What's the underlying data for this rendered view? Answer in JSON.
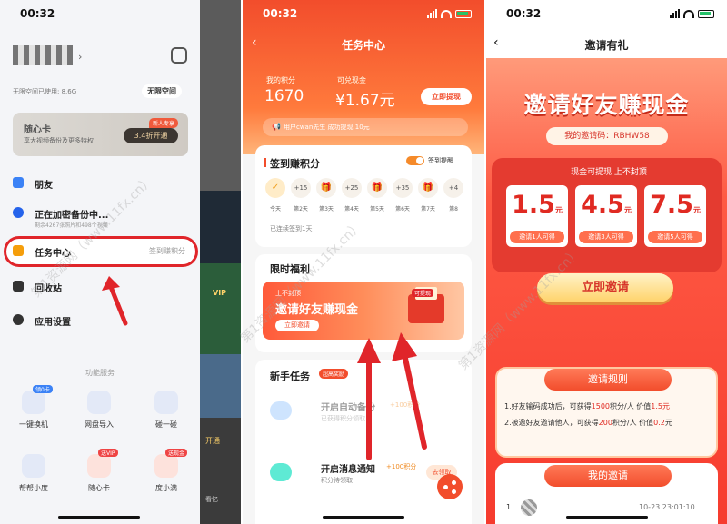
{
  "status": {
    "time": "00:32"
  },
  "left": {
    "storage": "无限空间已使用: 8.6G",
    "unlimited": "无限空间",
    "card": {
      "title": "随心卡",
      "sub": "享大视频备份及更多特权",
      "badge": "新人专享",
      "button": "3.4折开通"
    },
    "menu": [
      {
        "label": "朋友",
        "sub": "",
        "right": ""
      },
      {
        "label": "正在加密备份中...",
        "sub": "剩余4267张照片和498个视频",
        "right": ""
      },
      {
        "label": "任务中心",
        "sub": "",
        "right": "签到赚积分"
      },
      {
        "label": "回收站",
        "sub": "",
        "right": ""
      },
      {
        "label": "应用设置",
        "sub": "",
        "right": ""
      }
    ],
    "services_title": "功能服务",
    "services": [
      {
        "label": "一键换机",
        "tag": "领0卡"
      },
      {
        "label": "网盘导入",
        "tag": ""
      },
      {
        "label": "碰一碰",
        "tag": ""
      },
      {
        "label": "帮帮小度",
        "tag": ""
      },
      {
        "label": "随心卡",
        "tag": "送VIP"
      },
      {
        "label": "度小满",
        "tag": "送现金"
      }
    ],
    "behind": {
      "vip": "VIP",
      "open": "开通",
      "label": "看忆"
    }
  },
  "middle": {
    "title": "任务中心",
    "points_label": "我的积分",
    "points_value": "1670",
    "cash_label": "可兑现金",
    "cash_value": "¥1.67元",
    "withdraw": "立即提现",
    "notice_user": "用户cwan先生",
    "notice_text": "成功提现",
    "notice_amount": "10元",
    "signin_title": "签到赚积分",
    "remind_label": "签到提醒",
    "days": [
      {
        "reward": "✓",
        "label": "今天",
        "kind": "done"
      },
      {
        "reward": "+15",
        "label": "第2天",
        "kind": "pts"
      },
      {
        "reward": "🎁",
        "label": "第3天",
        "kind": "gift"
      },
      {
        "reward": "+25",
        "label": "第4天",
        "kind": "pts"
      },
      {
        "reward": "🎁",
        "label": "第5天",
        "kind": "gift"
      },
      {
        "reward": "+35",
        "label": "第6天",
        "kind": "pts"
      },
      {
        "reward": "🎁",
        "label": "第7天",
        "kind": "gift"
      },
      {
        "reward": "+4",
        "label": "第8",
        "kind": "pts"
      }
    ],
    "signed_text": "已连续签到1天",
    "limited_title": "限时福利",
    "banner": {
      "top": "上不封顶",
      "headline": "邀请好友赚现金",
      "button": "立即邀请",
      "tag": "可提现"
    },
    "newbie_title": "新手任务",
    "newbie_tag": "超高奖励",
    "tasks": [
      {
        "name": "开启自动备份",
        "sub": "已获得积分领取",
        "points": "+100积分",
        "button": ""
      },
      {
        "name": "开启消息通知",
        "sub": "积分待领取",
        "points": "+100积分",
        "button": "去领取"
      }
    ]
  },
  "right": {
    "title": "邀请有礼",
    "headline": "邀请好友赚现金",
    "code_label": "我的邀请码：",
    "code": "RBHW58",
    "prize_header": "现金可提现 上不封顶",
    "prizes": [
      {
        "amount": "1.5",
        "unit": "元",
        "cond": "邀请1人可得"
      },
      {
        "amount": "4.5",
        "unit": "元",
        "cond": "邀请3人可得"
      },
      {
        "amount": "7.5",
        "unit": "元",
        "cond": "邀请5人可得"
      }
    ],
    "invite_button": "立即邀请",
    "rules_title": "邀请规则",
    "rule1": {
      "a": "1.好友输码成功后，可获得",
      "b": "1500",
      "c": "积分/人 价值",
      "d": "1.5元"
    },
    "rule2": {
      "a": "2.被邀好友邀请他人，可获得",
      "b": "200",
      "c": "积分/人 价值",
      "d": "0.2",
      "e": "元"
    },
    "my_invites_title": "我的邀请",
    "invite_row": {
      "index": "1",
      "time": "10-23 23:01:10"
    }
  },
  "watermark": "第1资源网（www.11fx.cn）"
}
